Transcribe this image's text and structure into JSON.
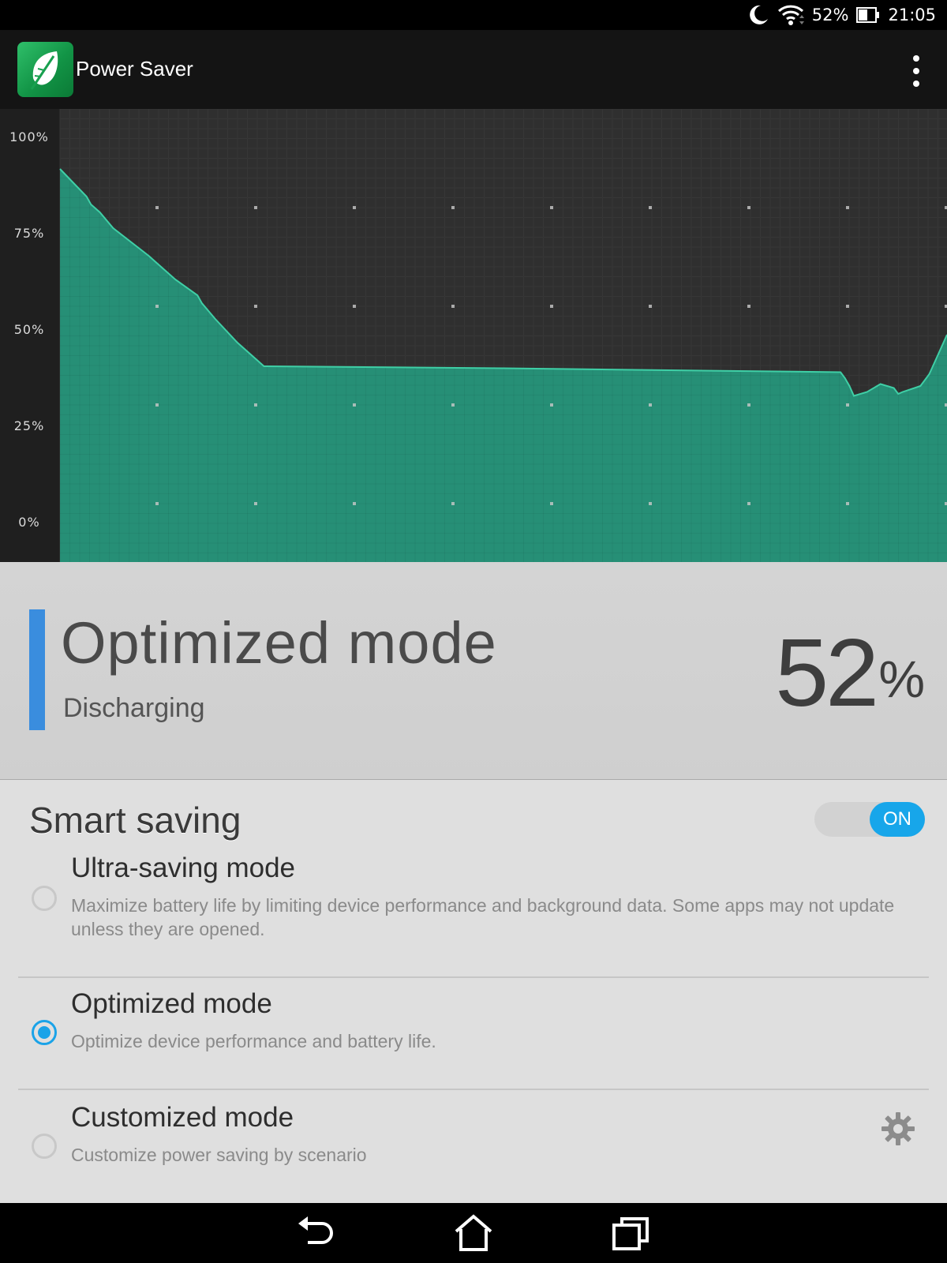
{
  "status_bar": {
    "battery_percent": "52%",
    "time": "21:05",
    "icons": [
      "moon-icon",
      "wifi-icon",
      "battery-icon"
    ]
  },
  "app_bar": {
    "title": "Power Saver",
    "app_icon": "leaf-icon",
    "menu_icon": "overflow-menu-icon"
  },
  "chart_data": {
    "type": "area",
    "y_tick_labels": [
      "100%",
      "75%",
      "50%",
      "25%",
      "0%"
    ],
    "ylim": [
      0,
      100
    ],
    "xlim": [
      0,
      1
    ],
    "grid": true,
    "fill_color": "#26957a",
    "line_color": "#3fcfa6",
    "x": [
      0,
      0.03,
      0.035,
      0.045,
      0.06,
      0.1,
      0.11,
      0.13,
      0.155,
      0.16,
      0.175,
      0.2,
      0.22,
      0.23,
      0.232,
      0.5,
      0.88,
      0.885,
      0.89,
      0.895,
      0.91,
      0.925,
      0.94,
      0.945,
      0.95,
      0.97,
      0.98,
      0.99,
      1.0
    ],
    "y": [
      92,
      85,
      83,
      81,
      77,
      70,
      68,
      64,
      60,
      58,
      54,
      48,
      44,
      42,
      42,
      41.5,
      40.5,
      39,
      37,
      34.5,
      35.5,
      37.5,
      36.5,
      35,
      35.5,
      37,
      40,
      45,
      50
    ]
  },
  "mode_panel": {
    "mode_name": "Optimized mode",
    "charge_state": "Discharging",
    "battery_value": "52",
    "battery_unit": "%",
    "accent_color": "#3a8dde"
  },
  "smart_saving": {
    "title": "Smart saving",
    "toggle_label": "ON",
    "toggle_on": true,
    "options": [
      {
        "title": "Ultra-saving mode",
        "description": "Maximize battery life by limiting device performance and background data. Some apps may not update unless they are opened.",
        "selected": false
      },
      {
        "title": "Optimized mode",
        "description": "Optimize device performance and battery life.",
        "selected": true
      },
      {
        "title": "Customized mode",
        "description": "Customize power saving by scenario",
        "selected": false,
        "settings_icon": "gear-icon"
      }
    ]
  },
  "nav_bar": {
    "buttons": [
      "back-icon",
      "home-icon",
      "recents-icon"
    ]
  }
}
